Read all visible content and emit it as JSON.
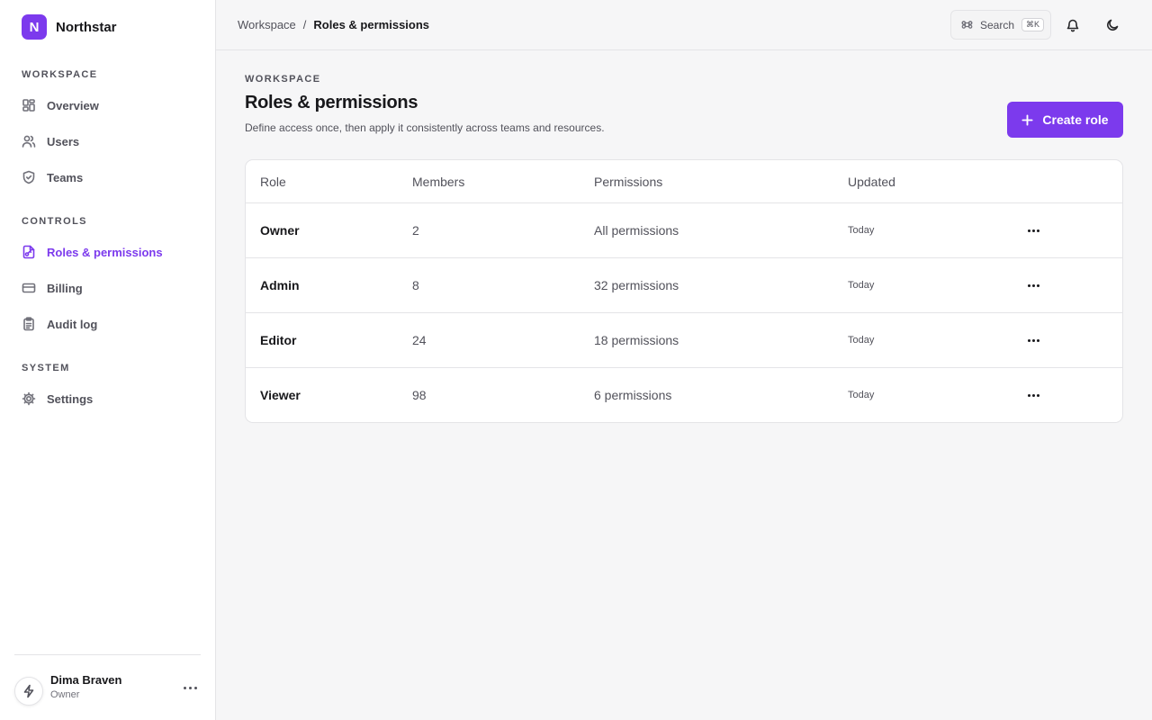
{
  "brand": {
    "initial": "N",
    "name": "Northstar"
  },
  "sidebar": {
    "sections": [
      {
        "title": "WORKSPACE",
        "items": [
          {
            "label": "Overview",
            "icon": "grid-icon"
          },
          {
            "label": "Users",
            "icon": "users-icon"
          },
          {
            "label": "Teams",
            "icon": "shield-icon"
          }
        ]
      },
      {
        "title": "CONTROLS",
        "items": [
          {
            "label": "Roles & permissions",
            "icon": "file-key-icon",
            "active": true
          },
          {
            "label": "Billing",
            "icon": "credit-card-icon"
          },
          {
            "label": "Audit log",
            "icon": "clipboard-icon"
          }
        ]
      },
      {
        "title": "SYSTEM",
        "items": [
          {
            "label": "Settings",
            "icon": "gear-icon"
          }
        ]
      }
    ]
  },
  "user": {
    "name": "Dima Braven",
    "role": "Owner"
  },
  "topbar": {
    "breadcrumb": {
      "parent": "Workspace",
      "separator": "/",
      "current": "Roles & permissions"
    },
    "search_label": "Search",
    "search_shortcut": "⌘K"
  },
  "page": {
    "eyebrow": "WORKSPACE",
    "title": "Roles & permissions",
    "description": "Define access once, then apply it consistently across teams and resources.",
    "create_label": "Create role"
  },
  "table": {
    "headers": {
      "role": "Role",
      "members": "Members",
      "permissions": "Permissions",
      "updated": "Updated"
    },
    "rows": [
      {
        "role": "Owner",
        "members": "2",
        "permissions": "All permissions",
        "updated": "Today"
      },
      {
        "role": "Admin",
        "members": "8",
        "permissions": "32 permissions",
        "updated": "Today"
      },
      {
        "role": "Editor",
        "members": "24",
        "permissions": "18 permissions",
        "updated": "Today"
      },
      {
        "role": "Viewer",
        "members": "98",
        "permissions": "6 permissions",
        "updated": "Today"
      }
    ]
  },
  "colors": {
    "accent": "#7c3aed",
    "background": "#f6f6f7",
    "border": "#e4e4e7"
  }
}
